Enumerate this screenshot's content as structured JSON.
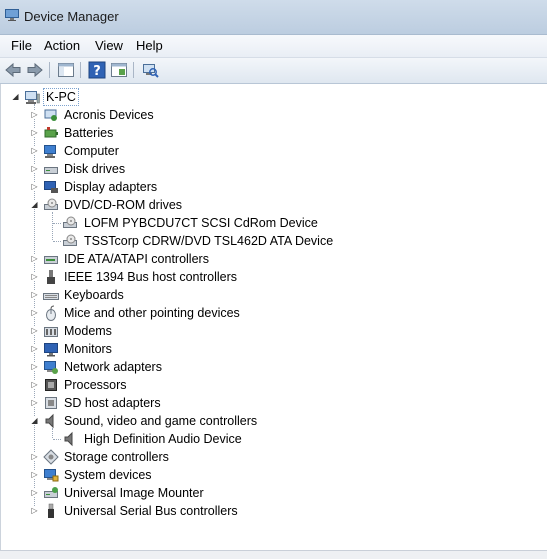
{
  "window": {
    "title": "Device Manager"
  },
  "menu": [
    "File",
    "Action",
    "View",
    "Help"
  ],
  "toolbar": {
    "buttons": [
      "back-icon",
      "forward-icon",
      "show-hide-console-tree-icon",
      "help-icon",
      "properties-icon",
      "scan-hardware-icon"
    ]
  },
  "tree": {
    "root": "K-PC",
    "categories": [
      {
        "label": "Acronis Devices",
        "icon": "device-icon",
        "expanded": false,
        "children": []
      },
      {
        "label": "Batteries",
        "icon": "battery-icon",
        "expanded": false,
        "children": []
      },
      {
        "label": "Computer",
        "icon": "computer-icon",
        "expanded": false,
        "children": []
      },
      {
        "label": "Disk drives",
        "icon": "disk-drive-icon",
        "expanded": false,
        "children": []
      },
      {
        "label": "Display adapters",
        "icon": "display-adapter-icon",
        "expanded": false,
        "children": []
      },
      {
        "label": "DVD/CD-ROM drives",
        "icon": "dvd-drive-icon",
        "expanded": true,
        "children": [
          "LOFM PYBCDU7CT SCSI CdRom Device",
          "TSSTcorp CDRW/DVD TSL462D ATA Device"
        ]
      },
      {
        "label": "IDE ATA/ATAPI controllers",
        "icon": "ide-controller-icon",
        "expanded": false,
        "children": []
      },
      {
        "label": "IEEE 1394 Bus host controllers",
        "icon": "ieee1394-icon",
        "expanded": false,
        "children": []
      },
      {
        "label": "Keyboards",
        "icon": "keyboard-icon",
        "expanded": false,
        "children": []
      },
      {
        "label": "Mice and other pointing devices",
        "icon": "mouse-icon",
        "expanded": false,
        "children": []
      },
      {
        "label": "Modems",
        "icon": "modem-icon",
        "expanded": false,
        "children": []
      },
      {
        "label": "Monitors",
        "icon": "monitor-icon",
        "expanded": false,
        "children": []
      },
      {
        "label": "Network adapters",
        "icon": "network-adapter-icon",
        "expanded": false,
        "children": []
      },
      {
        "label": "Processors",
        "icon": "processor-icon",
        "expanded": false,
        "children": []
      },
      {
        "label": "SD host adapters",
        "icon": "sd-host-icon",
        "expanded": false,
        "children": []
      },
      {
        "label": "Sound, video and game controllers",
        "icon": "speaker-icon",
        "expanded": true,
        "children": [
          "High Definition Audio Device"
        ]
      },
      {
        "label": "Storage controllers",
        "icon": "storage-controller-icon",
        "expanded": false,
        "children": []
      },
      {
        "label": "System devices",
        "icon": "system-devices-icon",
        "expanded": false,
        "children": []
      },
      {
        "label": "Universal Image Mounter",
        "icon": "image-mounter-icon",
        "expanded": false,
        "children": []
      },
      {
        "label": "Universal Serial Bus controllers",
        "icon": "usb-icon",
        "expanded": false,
        "children": []
      }
    ]
  },
  "colors": {
    "titlebar": "#c4d4e6",
    "selection_border": "#7da2ce",
    "tree_lines": "#9aa7b8"
  }
}
